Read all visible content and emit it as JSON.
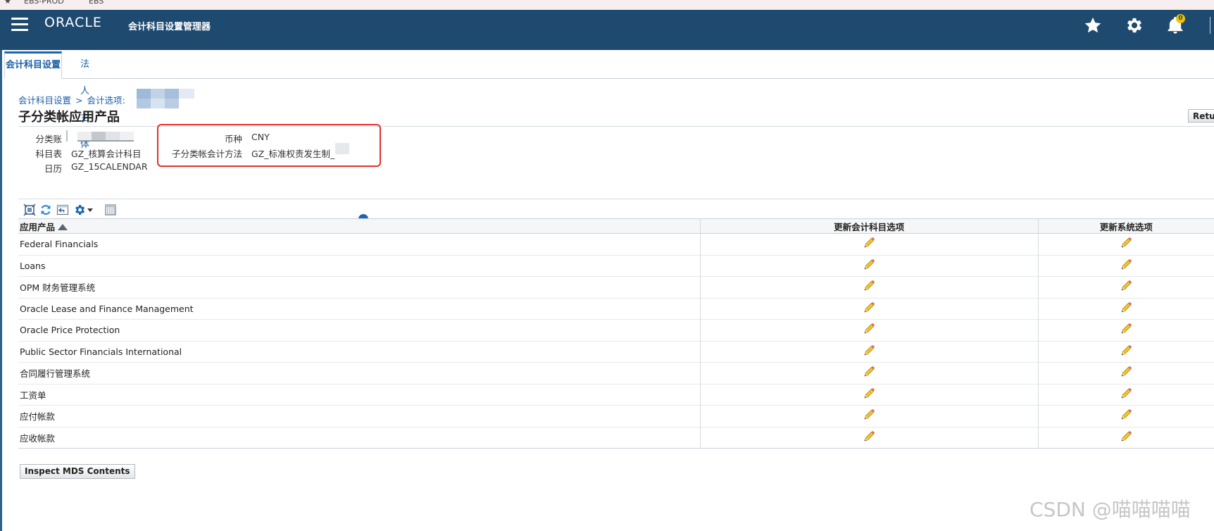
{
  "browser_bar": {
    "bookmark_1": "EBS-PROD",
    "bookmark_2": "EBS"
  },
  "header": {
    "logo": "ORACLE",
    "app_title": "会计科目设置管理器",
    "notification_count": "0",
    "icons": [
      "menu-icon",
      "favorites-star-icon",
      "settings-gear-icon",
      "notifications-bell-icon"
    ]
  },
  "tabs": [
    {
      "label": "会计科目设置",
      "active": true
    },
    {
      "label": "法人主体",
      "active": false
    }
  ],
  "breadcrumb": {
    "item_1": "会计科目设置",
    "separator": ">",
    "item_2": "会计选项:"
  },
  "page_title": "子分类帐应用产品",
  "return_button": "Retu",
  "info": {
    "ledger_label": "分类账",
    "ledger_value": "",
    "chart_label": "科目表",
    "chart_value": "GZ_核算会计科目",
    "calendar_label": "日历",
    "calendar_value": "GZ_15CALENDAR",
    "currency_label": "币种",
    "currency_value": "CNY",
    "method_label": "子分类帐会计方法",
    "method_value": "GZ_标准权责发生制_"
  },
  "table": {
    "columns": [
      "应用产品",
      "更新会计科目选项",
      "更新系统选项"
    ],
    "rows": [
      "Federal Financials",
      "Loans",
      "OPM 财务管理系统",
      "Oracle Lease and Finance Management",
      "Oracle Price Protection",
      "Public Sector Financials International",
      "合同履行管理系统",
      "工资单",
      "应付帐款",
      "应收帐款"
    ]
  },
  "inspect_button": "Inspect MDS Contents",
  "watermark": "CSDN @喵喵喵喵",
  "colors": {
    "header_bg": "#1f4a70",
    "link": "#1b5ea5",
    "highlight_frame": "#e0312b"
  }
}
